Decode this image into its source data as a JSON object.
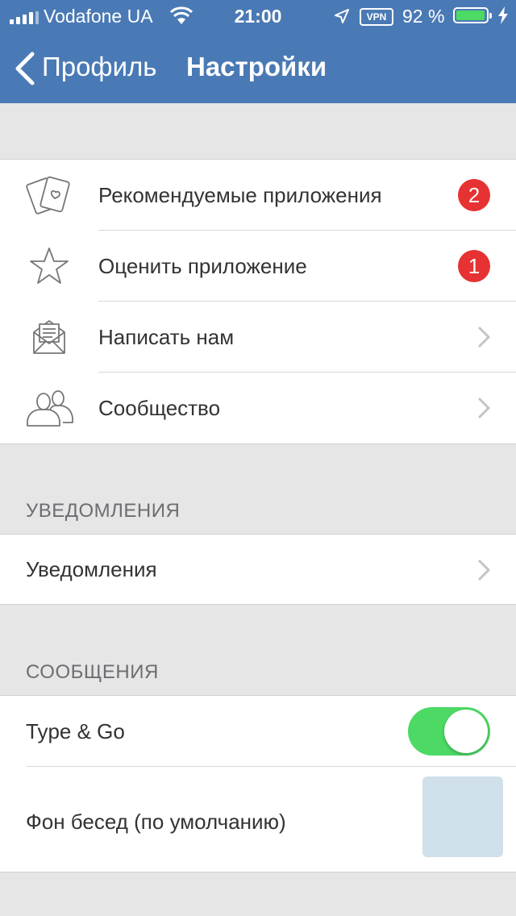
{
  "status": {
    "carrier": "Vodafone UA",
    "time": "21:00",
    "vpn": "VPN",
    "battery": "92 %",
    "battery_level": 0.92
  },
  "nav": {
    "back_label": "Профиль",
    "title": "Настройки"
  },
  "group1": {
    "items": [
      {
        "label": "Рекомендуемые приложения",
        "icon": "cards-heart-icon",
        "badge": "2"
      },
      {
        "label": "Оценить приложение",
        "icon": "star-icon",
        "badge": "1"
      },
      {
        "label": "Написать нам",
        "icon": "envelope-icon"
      },
      {
        "label": "Сообщество",
        "icon": "users-icon"
      }
    ]
  },
  "notifications": {
    "header": "УВЕДОМЛЕНИЯ",
    "item_label": "Уведомления"
  },
  "messages": {
    "header": "СООБЩЕНИЯ",
    "type_go_label": "Type & Go",
    "type_go_on": true,
    "background_label": "Фон бесед (по умолчанию)",
    "background_color": "#cfe0ea"
  },
  "colors": {
    "navbar": "#4a7ab5",
    "badge": "#e63232",
    "toggle_on": "#4cd964"
  }
}
